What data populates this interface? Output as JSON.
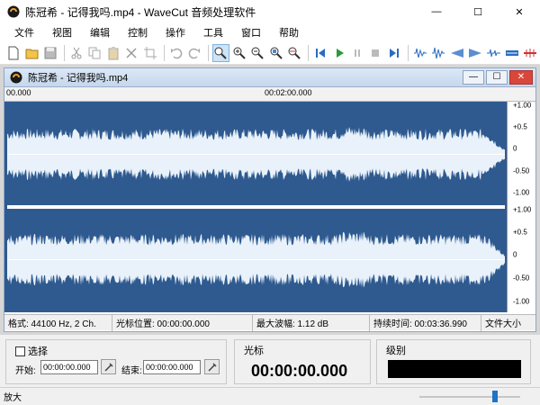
{
  "window": {
    "title": "陈冠希 - 记得我吗.mp4 - WaveCut 音频处理软件",
    "minimize_glyph": "—",
    "maximize_glyph": "☐",
    "close_glyph": "✕"
  },
  "menu": [
    "文件",
    "视图",
    "编辑",
    "控制",
    "操作",
    "工具",
    "窗口",
    "帮助"
  ],
  "document": {
    "title": "陈冠希 - 记得我吗.mp4",
    "ruler_start": "00.000",
    "ruler_mid": "00:02:00.000",
    "scale_labels": [
      "+1.00",
      "+0.5",
      "0",
      "-0.50",
      "-1.00"
    ]
  },
  "status": {
    "format": "格式: 44100 Hz, 2 Ch.",
    "cursor_position": "光标位置: 00:00:00.000",
    "max_amplitude": "最大波幅: 1.12 dB",
    "duration": "持续时间: 00:03:36.990",
    "file_size": "文件大小"
  },
  "selection": {
    "checkbox_label": "选择",
    "start_label": "开始:",
    "start_value": "00:00:00.000",
    "end_label": "结束:",
    "end_value": "00:00:00.000"
  },
  "cursor": {
    "label": "光标",
    "time": "00:00:00.000"
  },
  "level": {
    "label": "级别"
  },
  "bottom_status": {
    "text": "放大",
    "zoom_level": 0.75
  },
  "colors": {
    "wave_fill": "#2f5a8f",
    "wave_center": "#e9f2fb",
    "accent": "#1e73c6"
  }
}
